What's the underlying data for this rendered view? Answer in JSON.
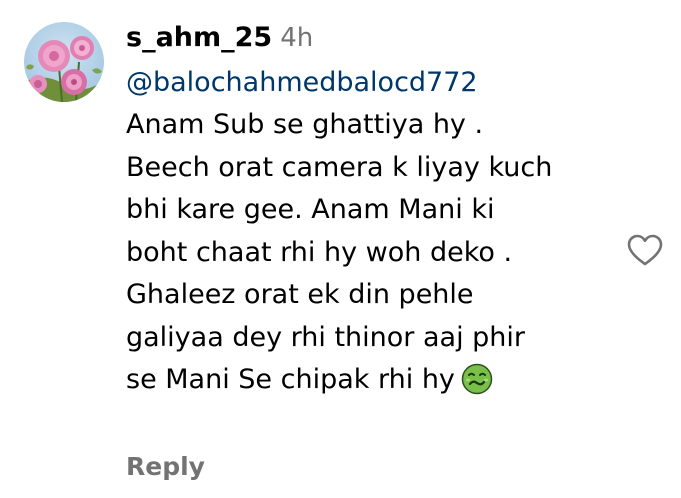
{
  "comment": {
    "username": "s_ahm_25",
    "timestamp": "4h",
    "mention": "@balochahmedbalocd772",
    "lines": [
      "Anam Sub se ghattiya hy .",
      "Beech orat camera k liyay kuch",
      "bhi kare gee. Anam Mani ki",
      "boht chaat rhi hy woh deko .",
      "Ghaleez orat ek din pehle",
      "galiyaa dey rhi thinor aaj phir",
      "se Mani Se chipak rhi hy"
    ],
    "emoji": "nauseated-face",
    "reply_label": "Reply"
  },
  "icons": {
    "like": "heart-outline-icon",
    "avatar": "pink-flowers-avatar"
  },
  "colors": {
    "username": "#000000",
    "timestamp": "#737373",
    "mention": "#00376b",
    "reply": "#737373",
    "emoji_face": "#79c04b"
  }
}
